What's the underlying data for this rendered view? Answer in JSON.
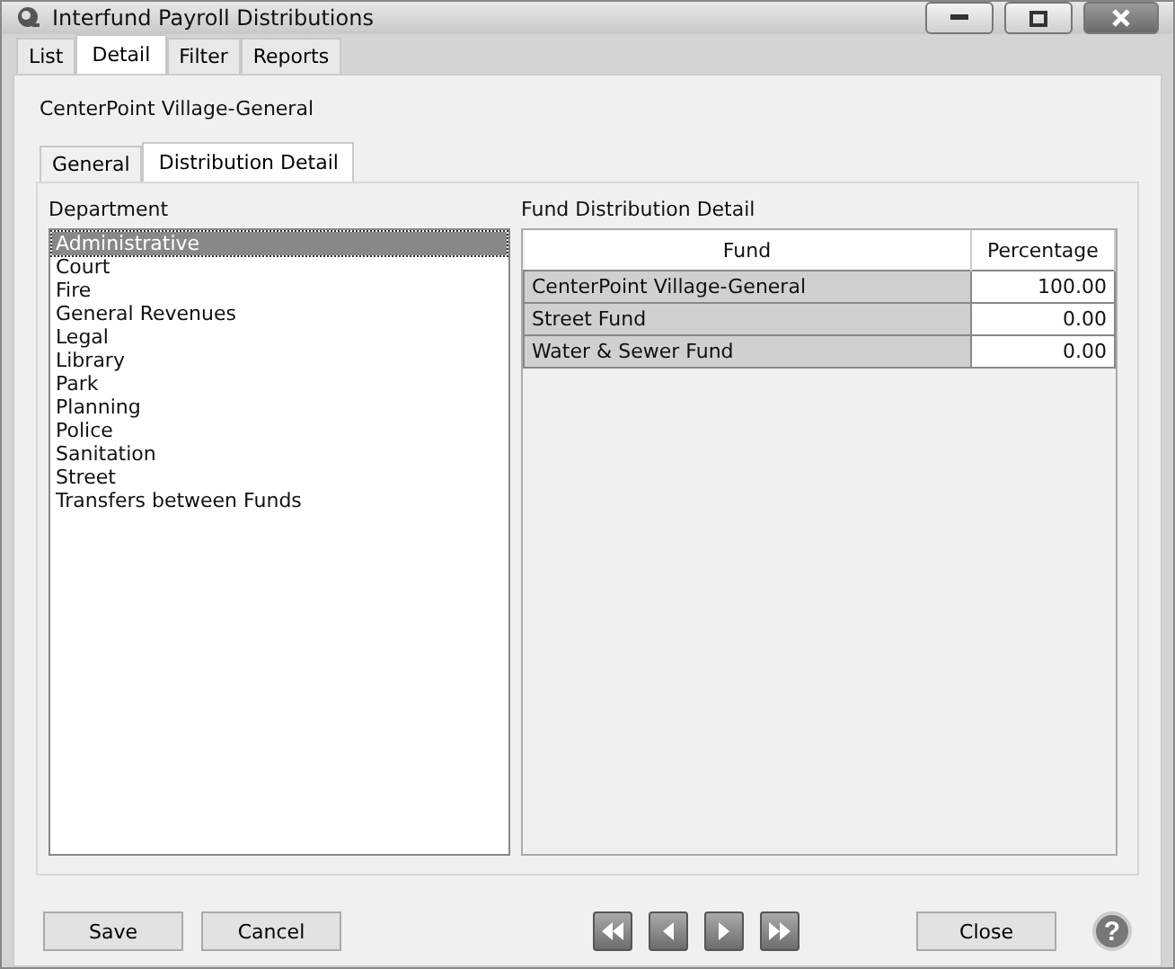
{
  "window": {
    "title": "Interfund Payroll Distributions"
  },
  "tabs": [
    {
      "label": "List",
      "selected": false
    },
    {
      "label": "Detail",
      "selected": true
    },
    {
      "label": "Filter",
      "selected": false
    },
    {
      "label": "Reports",
      "selected": false
    }
  ],
  "record_name": "CenterPoint Village-General",
  "subtabs": [
    {
      "label": "General",
      "selected": false
    },
    {
      "label": "Distribution Detail",
      "selected": true
    }
  ],
  "department": {
    "label": "Department",
    "items": [
      {
        "label": "Administrative",
        "selected": true
      },
      {
        "label": "Court",
        "selected": false
      },
      {
        "label": "Fire",
        "selected": false
      },
      {
        "label": "General Revenues",
        "selected": false
      },
      {
        "label": "Legal",
        "selected": false
      },
      {
        "label": "Library",
        "selected": false
      },
      {
        "label": "Park",
        "selected": false
      },
      {
        "label": "Planning",
        "selected": false
      },
      {
        "label": "Police",
        "selected": false
      },
      {
        "label": "Sanitation",
        "selected": false
      },
      {
        "label": "Street",
        "selected": false
      },
      {
        "label": "Transfers between Funds",
        "selected": false
      }
    ]
  },
  "fund_distribution": {
    "label": "Fund Distribution Detail",
    "columns": [
      "Fund",
      "Percentage"
    ],
    "rows": [
      {
        "fund": "CenterPoint Village-General",
        "percentage": "100.00"
      },
      {
        "fund": "Street Fund",
        "percentage": "0.00"
      },
      {
        "fund": "Water & Sewer Fund",
        "percentage": "0.00"
      }
    ]
  },
  "buttons": {
    "save": "Save",
    "cancel": "Cancel",
    "close": "Close",
    "help": "?"
  },
  "navigation": [
    {
      "kind": "first"
    },
    {
      "kind": "previous"
    },
    {
      "kind": "next"
    },
    {
      "kind": "last"
    }
  ]
}
